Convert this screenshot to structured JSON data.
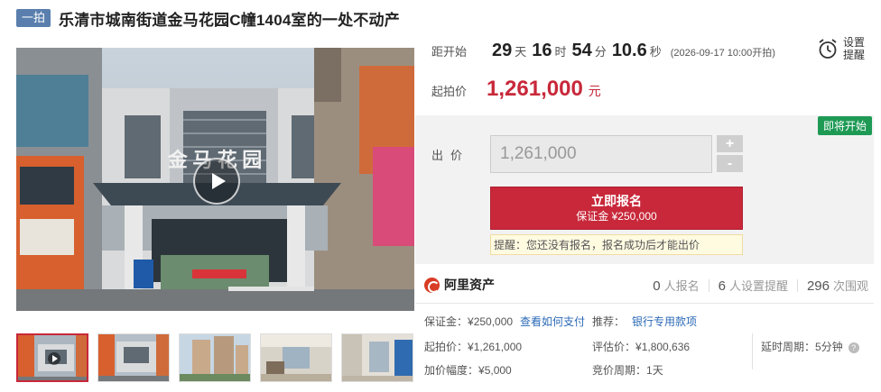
{
  "header": {
    "badge": "一拍",
    "title": "乐清市城南街道金马花园C幢1404室的一处不动产"
  },
  "media": {
    "sign_text": "金 马 花 园",
    "thumbnail_count": 5
  },
  "countdown": {
    "label": "距开始",
    "days": "29",
    "days_unit": "天",
    "hours": "16",
    "hours_unit": "时",
    "minutes": "54",
    "minutes_unit": "分",
    "seconds": "10.6",
    "seconds_unit": "秒",
    "start_note": "(2026-09-17 10:00开拍)"
  },
  "reminder": {
    "label": "设置提醒",
    "icon": "alarm-clock-icon"
  },
  "start_price": {
    "label": "起拍价",
    "value": "1,261,000",
    "unit": "元"
  },
  "bid": {
    "status_badge": "即将开始",
    "label": "出价",
    "input_value": "1,261,000",
    "plus": "+",
    "minus": "-",
    "signup_label": "立即报名",
    "deposit_label": "保证金 ¥250,000",
    "tip": "提醒：您还没有报名，报名成功后才能出价"
  },
  "platform": {
    "name": "阿里资产",
    "logo_color": "#d83c24",
    "signup_count": "0",
    "signup_text": "人报名",
    "reminder_count": "6",
    "reminder_text": "人设置提醒",
    "viewer_count": "296",
    "viewer_text": "次围观"
  },
  "details": {
    "deposit_label": "保证金：",
    "deposit_value": "¥250,000",
    "how_to_pay": "查看如何支付",
    "recommend_label": "推荐：",
    "recommend_link": "银行专用款项",
    "start_price_label": "起拍价：",
    "start_price_value": "¥1,261,000",
    "appraisal_label": "评估价：",
    "appraisal_value": "¥1,800,636",
    "delay_label": "延时周期：",
    "delay_value": "5分钟",
    "increment_label": "加价幅度：",
    "increment_value": "¥5,000",
    "bid_period_label": "竞价周期：",
    "bid_period_value": "1天"
  },
  "colors": {
    "accent": "#c8283a",
    "badge": "#5a7fae",
    "status_green": "#1e9a55",
    "link": "#2b6ab7"
  }
}
